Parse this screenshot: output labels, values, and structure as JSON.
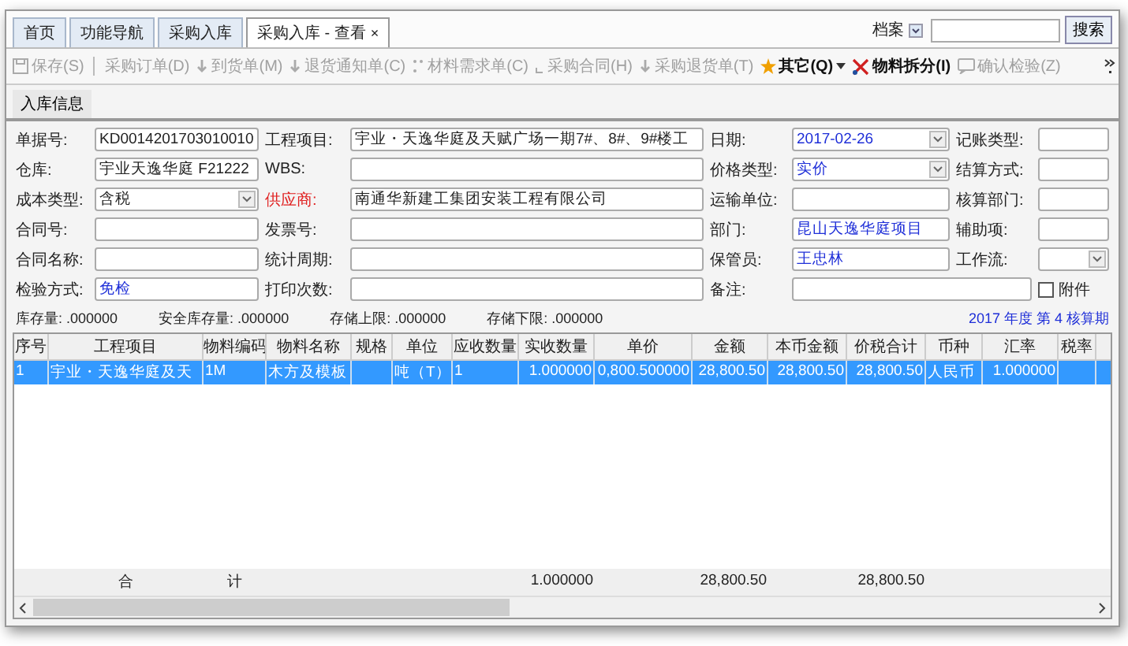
{
  "tabs": [
    {
      "label": "首页",
      "selected": false
    },
    {
      "label": "功能导航",
      "selected": false
    },
    {
      "label": "采购入库",
      "selected": false
    },
    {
      "label": "采购入库 - 查看",
      "selected": true,
      "close": "×"
    }
  ],
  "archive_select": {
    "value": "档案"
  },
  "search": {
    "button": "搜索"
  },
  "toolbar": [
    {
      "label": "保存(S)",
      "disabled": true,
      "kind": "button"
    },
    {
      "label": "采购订单(D)",
      "disabled": true,
      "kind": "button"
    },
    {
      "label": "到货单(M)",
      "disabled": true,
      "kind": "button"
    },
    {
      "label": "退货通知单(C)",
      "disabled": true,
      "kind": "button"
    },
    {
      "label": "材料需求单(C)",
      "disabled": true,
      "kind": "button"
    },
    {
      "label": "采购合同(H)",
      "disabled": true,
      "kind": "button"
    },
    {
      "label": "采购退货单(T)",
      "disabled": true,
      "kind": "button"
    },
    {
      "label": "其它(Q)",
      "disabled": false,
      "kind": "dropdown"
    },
    {
      "label": "物料拆分(I)",
      "disabled": false,
      "kind": "button"
    },
    {
      "label": "确认检验(Z)",
      "disabled": true,
      "kind": "button"
    }
  ],
  "subtab": {
    "label": "入库信息",
    "selected": true
  },
  "fields": [
    {
      "label": "单据号:",
      "value": "KD0014201703010010",
      "kind": "text"
    },
    {
      "label": "工程项目:",
      "value": "宇业・天逸华庭及天赋广场一期7#、8#、9#楼工",
      "kind": "text"
    },
    {
      "label": "日期:",
      "value": "2017-02-26",
      "kind": "select",
      "highlight": true
    },
    {
      "label": "记账类型:",
      "kind": "text"
    },
    {
      "label": "仓库:",
      "value": "宇业天逸华庭  F21222",
      "kind": "text"
    },
    {
      "label": "WBS:",
      "kind": "text"
    },
    {
      "label": "价格类型:",
      "value": "实价",
      "kind": "select",
      "highlight": true
    },
    {
      "label": "结算方式:",
      "kind": "text"
    },
    {
      "label": "成本类型:",
      "value": "含税",
      "kind": "select"
    },
    {
      "label": "供应商:",
      "value": "南通华新建工集团安装工程有限公司",
      "kind": "text",
      "required": true
    },
    {
      "label": "运输单位:",
      "kind": "text"
    },
    {
      "label": "核算部门:",
      "kind": "text"
    },
    {
      "label": "合同号:",
      "kind": "text"
    },
    {
      "label": "发票号:",
      "kind": "text"
    },
    {
      "label": "部门:",
      "value": "昆山天逸华庭项目",
      "kind": "text",
      "highlight": true
    },
    {
      "label": "辅助项:",
      "kind": "text"
    },
    {
      "label": "合同名称:",
      "kind": "text"
    },
    {
      "label": "统计周期:",
      "kind": "text"
    },
    {
      "label": "保管员:",
      "value": "王忠林",
      "kind": "text",
      "highlight": true
    },
    {
      "label": "工作流:",
      "kind": "select"
    },
    {
      "label": "检验方式:",
      "value": "免检",
      "kind": "text",
      "highlight": true
    },
    {
      "label": "打印次数:",
      "kind": "text"
    },
    {
      "label": "备注:",
      "kind": "wide"
    },
    {
      "label": "附件",
      "kind": "checkbox",
      "checked": false
    }
  ],
  "stock_info": [
    {
      "label": "库存量:",
      "value": ".000000"
    },
    {
      "label": "安全库存量:",
      "value": ".000000"
    },
    {
      "label": "存储上限:",
      "value": ".000000"
    },
    {
      "label": "存储下限:",
      "value": ".000000"
    }
  ],
  "period": "2017 年度 第 4 核算期",
  "table": {
    "columns": [
      {
        "label": "序号",
        "kind": "text"
      },
      {
        "label": "工程项目",
        "kind": "text"
      },
      {
        "label": "物料编码",
        "kind": "text"
      },
      {
        "label": "物料名称",
        "kind": "text"
      },
      {
        "label": "规格"
      },
      {
        "label": "单位",
        "kind": "text"
      },
      {
        "label": "应收数量",
        "kind": "text"
      },
      {
        "label": "实收数量",
        "kind": "number"
      },
      {
        "label": "单价",
        "kind": "number"
      },
      {
        "label": "金额",
        "kind": "number"
      },
      {
        "label": "本币金额",
        "kind": "number"
      },
      {
        "label": "价税合计",
        "kind": "number"
      },
      {
        "label": "币种",
        "kind": "text"
      },
      {
        "label": "汇率",
        "kind": "number"
      },
      {
        "label": "税率"
      }
    ],
    "rows": [
      {
        "selected": true,
        "cells": [
          "1",
          "宇业・天逸华庭及天",
          "1M",
          "木方及模板",
          null,
          "吨（T）",
          "1",
          "1.000000",
          "0,800.500000",
          "28,800.50",
          "28,800.50",
          "28,800.50",
          "人民币",
          "1.000000",
          null
        ]
      }
    ],
    "totals": {
      "label_start": "合",
      "label_end": "计",
      "received_quantity": "1.000000",
      "amount": "28,800.50",
      "tax_inclusive_total": "28,800.50"
    }
  }
}
